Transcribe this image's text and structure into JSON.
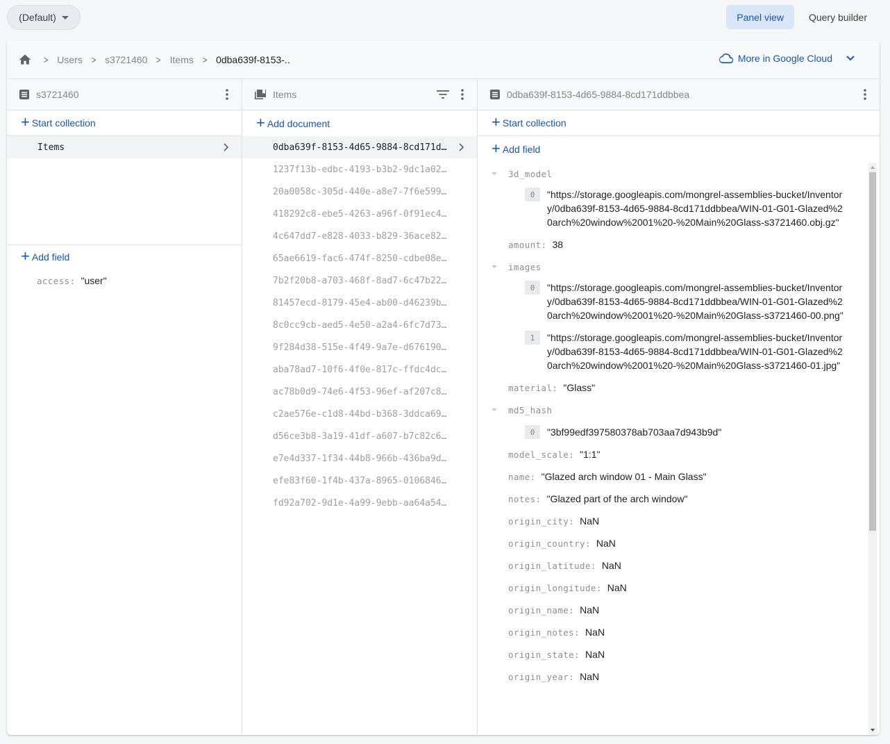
{
  "topbar": {
    "database_selector": "(Default)",
    "views": [
      {
        "label": "Panel view",
        "active": true
      },
      {
        "label": "Query builder",
        "active": false
      }
    ]
  },
  "breadcrumb": {
    "items": [
      "Users",
      "s3721460",
      "Items",
      "0dba639f-8153-.."
    ],
    "cloud_link": "More in Google Cloud"
  },
  "panel_user": {
    "title": "s3721460",
    "start_collection": "Start collection",
    "collections": [
      {
        "label": "Items",
        "selected": true
      }
    ],
    "add_field": "Add field",
    "fields": [
      {
        "key": "access",
        "value": "\"user\""
      }
    ]
  },
  "panel_items": {
    "title": "Items",
    "add_document": "Add document",
    "documents": [
      "0dba639f-8153-4d65-9884-8cd171d…",
      "1237f13b-edbc-4193-b3b2-9dc1a02…",
      "20a0058c-305d-440e-a8e7-7f6e599…",
      "418292c8-ebe5-4263-a96f-0f91ec4…",
      "4c647dd7-e828-4033-b829-36ace82…",
      "65ae6619-fac6-474f-8250-cdbe08e…",
      "7b2f20b8-a703-468f-8ad7-6c47b22…",
      "81457ecd-8179-45e4-ab00-d46239b…",
      "8c0cc9cb-aed5-4e50-a2a4-6fc7d73…",
      "9f284d38-515e-4f49-9a7e-d676190…",
      "aba78ad7-10f6-4f0e-817c-ffdc4dc…",
      "ac78b0d9-74e6-4f53-96ef-af207c8…",
      "c2ae576e-c1d8-44bd-b368-3ddca69…",
      "d56ce3b8-3a19-41df-a607-b7c82c6…",
      "e7e4d337-1f34-44b8-966b-436ba9d…",
      "efe83f60-1f4b-437a-8965-0106846…",
      "fd92a702-9d1e-4a99-9ebb-aa64a54…"
    ]
  },
  "panel_document": {
    "title": "0dba639f-8153-4d65-9884-8cd171ddbbea",
    "start_collection": "Start collection",
    "add_field": "Add field",
    "model_3d": {
      "key": "3d_model",
      "items": [
        {
          "index": "0",
          "value": "\"https://storage.googleapis.com/mongrel-assemblies-bucket/Inventory/0dba639f-8153-4d65-9884-8cd171ddbbea/WIN-01-G01-Glazed%20arch%20window%2001%20-%20Main%20Glass-s3721460.obj.gz\""
        }
      ]
    },
    "amount": {
      "key": "amount",
      "value": "38"
    },
    "images": {
      "key": "images",
      "items": [
        {
          "index": "0",
          "value": "\"https://storage.googleapis.com/mongrel-assemblies-bucket/Inventory/0dba639f-8153-4d65-9884-8cd171ddbbea/WIN-01-G01-Glazed%20arch%20window%2001%20-%20Main%20Glass-s3721460-00.png\""
        },
        {
          "index": "1",
          "value": "\"https://storage.googleapis.com/mongrel-assemblies-bucket/Inventory/0dba639f-8153-4d65-9884-8cd171ddbbea/WIN-01-G01-Glazed%20arch%20window%2001%20-%20Main%20Glass-s3721460-01.jpg\""
        }
      ]
    },
    "material": {
      "key": "material",
      "value": "\"Glass\""
    },
    "md5_hash": {
      "key": "md5_hash",
      "items": [
        {
          "index": "0",
          "value": "\"3bf99edf397580378ab703aa7d943b9d\""
        }
      ]
    },
    "simple_fields": [
      {
        "key": "model_scale",
        "value": "\"1:1\""
      },
      {
        "key": "name",
        "value": "\"Glazed arch window 01 - Main Glass\""
      },
      {
        "key": "notes",
        "value": "\"Glazed part of the arch window\""
      },
      {
        "key": "origin_city",
        "value": "NaN"
      },
      {
        "key": "origin_country",
        "value": "NaN"
      },
      {
        "key": "origin_latitude",
        "value": "NaN"
      },
      {
        "key": "origin_longitude",
        "value": "NaN"
      },
      {
        "key": "origin_name",
        "value": "NaN"
      },
      {
        "key": "origin_notes",
        "value": "NaN"
      },
      {
        "key": "origin_state",
        "value": "NaN"
      },
      {
        "key": "origin_year",
        "value": "NaN"
      }
    ]
  },
  "colors": {
    "accent": "#1a56a8",
    "active_view_bg": "#d8e6f7",
    "page_bg": "#f4f6f8"
  }
}
